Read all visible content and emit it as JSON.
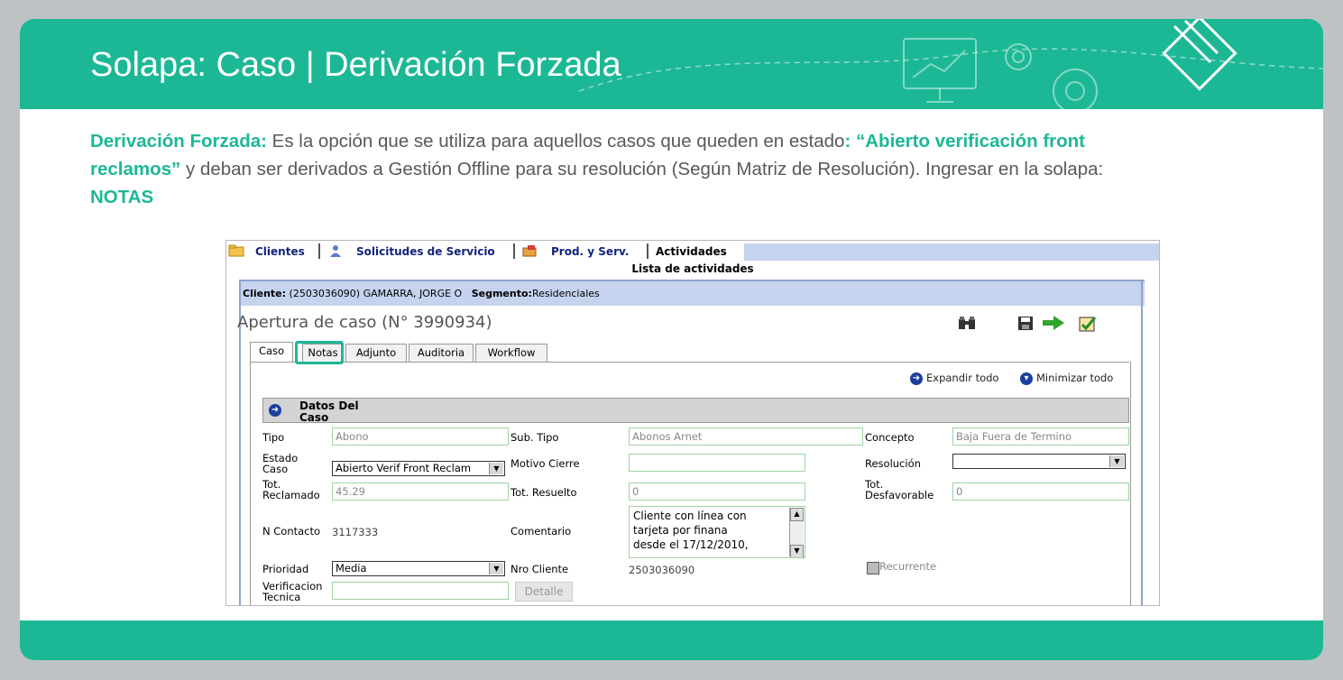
{
  "slide": {
    "title": "Solapa: Caso | Derivación Forzada",
    "intro": {
      "term": "Derivación Forzada:",
      "text1": " Es la opción que se utiliza para aquellos casos que queden en estado",
      "status": ": “Abierto verificación front reclamos”",
      "text2": " y deban ser derivados a Gestión Offline para su resolución (Según Matriz de Resolución).  Ingresar en la solapa: ",
      "tab": "NOTAS"
    },
    "accent_color": "#1cb895"
  },
  "app": {
    "top_tabs": [
      "Clientes",
      "Solicitudes de Servicio",
      "Prod. y Serv.",
      "Actividades"
    ],
    "list_title": "Lista de actividades",
    "client_label": "Cliente:",
    "client_value": "(2503036090) GAMARRA, JORGE O",
    "segment_label": "Segmento:",
    "segment_value": "Residenciales",
    "case_title": "Apertura de caso (N° 3990934)",
    "toolbar_icons": [
      "binoculars-icon",
      "save-icon",
      "forward-arrow-icon",
      "checklist-icon"
    ],
    "tabs": [
      "Caso",
      "Notas",
      "Adjunto",
      "Auditoria",
      "Workflow"
    ],
    "expand_all": "Expandir todo",
    "minimize_all": "Minimizar todo",
    "section_title_1": "Datos Del",
    "section_title_2": "Caso",
    "fields": {
      "tipo_label": "Tipo",
      "tipo_value": "Abono",
      "subtipo_label": "Sub. Tipo",
      "subtipo_value": "Abonos Arnet",
      "concepto_label": "Concepto",
      "concepto_value": "Baja Fuera de Termino",
      "estado_label_1": "Estado",
      "estado_label_2": "Caso",
      "estado_value": "Abierto Verif Front Reclam",
      "motivo_label": "Motivo Cierre",
      "motivo_value": "",
      "resolucion_label": "Resolución",
      "resolucion_value": "",
      "totrec_label_1": "Tot.",
      "totrec_label_2": "Reclamado",
      "totrec_value": "45.29",
      "totres_label": "Tot. Resuelto",
      "totres_value": "0",
      "totdes_label_1": "Tot.",
      "totdes_label_2": "Desfavorable",
      "totdes_value": "0",
      "ncontacto_label": "N Contacto",
      "ncontacto_value": "3117333",
      "comentario_label": "Comentario",
      "comentario_line1": "Cliente con línea con",
      "comentario_line2": "tarjeta por finana",
      "comentario_line3": "desde el 17/12/2010,",
      "prioridad_label": "Prioridad",
      "prioridad_value": "Media",
      "nrocliente_label": "Nro Cliente",
      "nrocliente_value": "2503036090",
      "recurrente_label": "Recurrente",
      "verif_label_1": "Verificacion",
      "verif_label_2": "Tecnica",
      "verif_value": "",
      "detalle_label": "Detalle"
    }
  }
}
